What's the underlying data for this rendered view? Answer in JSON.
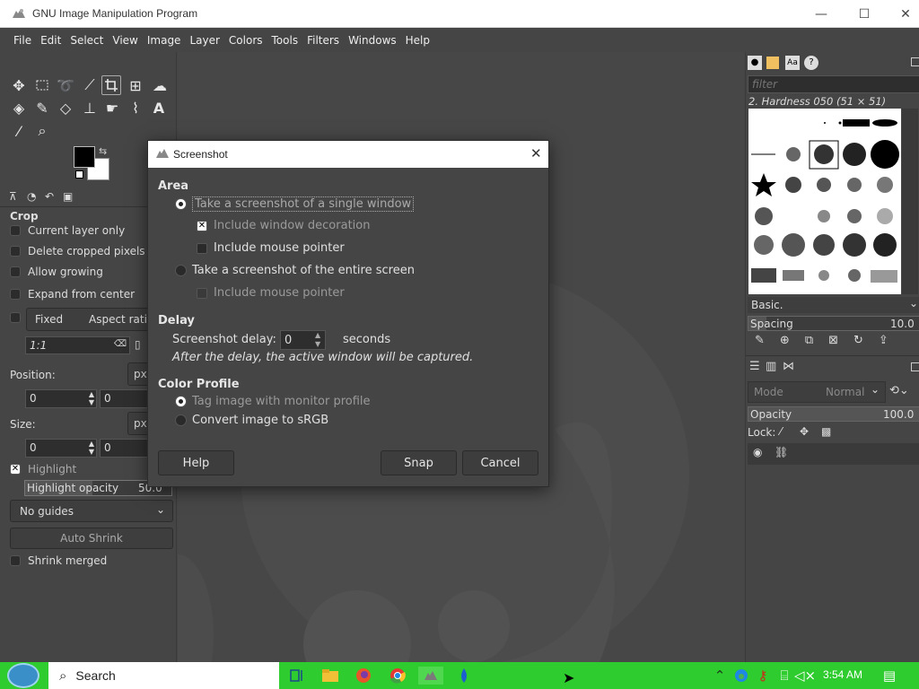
{
  "window": {
    "title": "GNU Image Manipulation Program",
    "minimize": "—",
    "maximize": "☐",
    "close": "✕"
  },
  "menu": [
    "File",
    "Edit",
    "Select",
    "View",
    "Image",
    "Layer",
    "Colors",
    "Tools",
    "Filters",
    "Windows",
    "Help"
  ],
  "tool_options": {
    "title": "Crop",
    "current_layer_only": "Current layer only",
    "delete_cropped": "Delete cropped pixels",
    "allow_growing": "Allow growing",
    "expand_center": "Expand from center",
    "fixed": "Fixed",
    "aspect": "Aspect ratio",
    "ratio_value": "1:1",
    "position_label": "Position:",
    "position_unit": "px",
    "pos_x": "0",
    "pos_y": "0",
    "size_label": "Size:",
    "size_unit": "px",
    "size_w": "0",
    "size_h": "0",
    "highlight": "Highlight",
    "highlight_opacity": "Highlight opacity",
    "highlight_opacity_value": "50.0",
    "guides": "No guides",
    "auto_shrink": "Auto Shrink",
    "shrink_merged": "Shrink merged"
  },
  "brushes": {
    "filter_placeholder": "filter",
    "current": "2. Hardness 050 (51 × 51)",
    "preset": "Basic.",
    "spacing_label": "Spacing",
    "spacing_value": "10.0"
  },
  "layers": {
    "mode_label": "Mode",
    "mode_value": "Normal",
    "opacity_label": "Opacity",
    "opacity_value": "100.0",
    "lock_label": "Lock:"
  },
  "dialog": {
    "title": "Screenshot",
    "area_heading": "Area",
    "single_window": "Take a screenshot of a single window",
    "include_decoration": "Include window decoration",
    "include_pointer_1": "Include mouse pointer",
    "entire_screen": "Take a screenshot of the entire screen",
    "include_pointer_2": "Include mouse pointer",
    "delay_heading": "Delay",
    "delay_label": "Screenshot delay:",
    "delay_value": "0",
    "delay_unit": "seconds",
    "delay_note": "After the delay, the active window will be captured.",
    "color_heading": "Color Profile",
    "tag_monitor": "Tag image with monitor profile",
    "convert_srgb": "Convert image to sRGB",
    "help": "Help",
    "snap": "Snap",
    "cancel": "Cancel"
  },
  "taskbar": {
    "search": "Search",
    "time": "3:54 AM"
  }
}
